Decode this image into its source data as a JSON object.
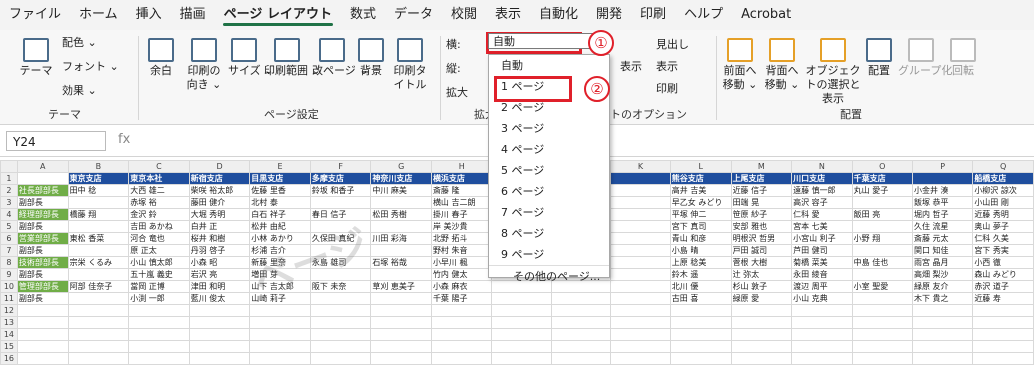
{
  "menu_tabs": [
    "ファイル",
    "ホーム",
    "挿入",
    "描画",
    "ページ レイアウト",
    "数式",
    "データ",
    "校閲",
    "表示",
    "自動化",
    "開発",
    "印刷",
    "ヘルプ",
    "Acrobat"
  ],
  "ribbon": {
    "theme_label": "テーマ",
    "colors": "配色 ⌄",
    "fonts": "フォント ⌄",
    "effects": "効果 ⌄",
    "group_theme": "テーマ",
    "margins": "余白",
    "orientation": "印刷の向き ⌄",
    "size": "サイズ ⌄",
    "print_area": "印刷範囲 ⌄",
    "breaks": "改ページ ⌄",
    "background": "背景",
    "print_titles": "印刷タイトル",
    "group_page_setup": "ページ設定",
    "width_label": "横:",
    "height_label": "縦:",
    "scale_label": "拡大",
    "group_scale": "拡大",
    "gridlines": "表示",
    "headings_title": "見出し",
    "headings_view": "表示",
    "headings_print": "印刷",
    "group_sheet_options": "トのオプション",
    "bring_forward": "前面へ移動 ⌄",
    "send_backward": "背面へ移動 ⌄",
    "selection_pane": "オブジェクトの選択と表示",
    "align": "配置",
    "group": "グループ化",
    "rotate": "回転",
    "group_arrange": "配置"
  },
  "formula": {
    "namebox": "Y24",
    "fx": "fx"
  },
  "dropdown": {
    "value": "自動",
    "items": [
      "自動",
      "1 ページ",
      "2 ページ",
      "3 ページ",
      "4 ページ",
      "5 ページ",
      "6 ページ",
      "7 ページ",
      "8 ページ",
      "9 ページ"
    ],
    "more": "その他のページ..."
  },
  "badges": [
    "①",
    "②"
  ],
  "sheet": {
    "columns": [
      "A",
      "B",
      "C",
      "D",
      "E",
      "F",
      "G",
      "H",
      "I",
      "J",
      "K",
      "L",
      "M",
      "N",
      "O",
      "P",
      "Q"
    ],
    "rows": [
      [
        "",
        "東京支店",
        "東京本社",
        "新宿支店",
        "目黒支店",
        "多摩支店",
        "神奈川支店",
        "横浜支店",
        "",
        "",
        "",
        "熊谷支店",
        "上尾支店",
        "川口支店",
        "千葉支店",
        "",
        "船橋支店"
      ],
      [
        "社長部部長",
        "田中 稔",
        "大西 雄二",
        "柴咲 裕太郎",
        "佐藤 里香",
        "鈴坂 和香子",
        "中川 麻美",
        "斎藤 隆",
        "",
        "",
        "",
        "高井 吉美",
        "近藤 信子",
        "遠藤 慎一郎",
        "丸山 愛子",
        "小金井 湊",
        "小柳沢 諒次"
      ],
      [
        "副部長",
        "",
        "赤塚 裕",
        "藤田 健介",
        "北村 泰",
        "",
        "",
        "横山 吉二朗",
        "",
        "",
        "",
        "早乙女 みどり",
        "田端 晃",
        "高沢 容子",
        "",
        "飯塚 恭平",
        "小山田 剛"
      ],
      [
        "経理部部長",
        "橋藤 翔",
        "金沢 鈴",
        "大堀 秀明",
        "白石 祥子",
        "春日 信子",
        "松田 秀樹",
        "掛川 春子",
        "",
        "",
        "",
        "平塚 伸二",
        "笹原 紗子",
        "仁科 愛",
        "飯田 亮",
        "堀内 哲子",
        "近藤 秀明"
      ],
      [
        "副部長",
        "",
        "吉田 あかね",
        "白井 正",
        "松井 由紀",
        "",
        "",
        "岸 美沙貴",
        "",
        "",
        "",
        "宮下 真司",
        "安部 雅也",
        "宮本 七美",
        "",
        "久住 流星",
        "奥山 夢子"
      ],
      [
        "営業部部長",
        "東松 香菜",
        "河合 竜也",
        "桜井 和樹",
        "小林 あかり",
        "久保田 真紀",
        "川田 彩海",
        "北野 拓斗",
        "",
        "",
        "",
        "青山 和彦",
        "明根沢 哲男",
        "小宮山 利子",
        "小野 翔",
        "斎藤 元太",
        "仁科 久美"
      ],
      [
        "副部長",
        "",
        "原 正太",
        "丹羽 啓子",
        "杉浦 吉介",
        "",
        "",
        "野村 朱音",
        "",
        "",
        "",
        "小島 晴",
        "戸田 誠司",
        "芦田 健司",
        "",
        "関口 知佳",
        "宮下 秀実"
      ],
      [
        "技術部部長",
        "宗栄 くるみ",
        "小山 慎太郎",
        "小森 昭",
        "新藤 里奈",
        "永島 雄司",
        "石塚 裕哉",
        "小早川 楓",
        "",
        "",
        "",
        "上原 稔美",
        "菅根 大樹",
        "菊橋 菜美",
        "中島 佳也",
        "雨宮 晶月",
        "小西 徹"
      ],
      [
        "副部長",
        "",
        "五十嵐 義史",
        "岩沢 亮",
        "増田 芽",
        "",
        "",
        "竹内 健太",
        "",
        "",
        "",
        "鈴木 遥",
        "辻 弥太",
        "永田 綾音",
        "",
        "高畑 梨沙",
        "森山 みどり"
      ],
      [
        "管理部部長",
        "阿部 佳奈子",
        "當岡 正博",
        "津田 和明",
        "山下 吉太郎",
        "阪下 未奈",
        "草刈 恵美子",
        "小森 麻衣",
        "",
        "",
        "",
        "北川 優",
        "杉山 敦子",
        "渡辺 周平",
        "小室 聖愛",
        "緑原 友介",
        "赤沢 道子"
      ],
      [
        "副部長",
        "",
        "小渕 一郎",
        "藍川 俊太",
        "山崎 莉子",
        "",
        "",
        "千葉 陽子",
        "",
        "",
        "",
        "古田 喜",
        "緑原 愛",
        "小山 克典",
        "",
        "木下 貴之",
        "近藤 寿"
      ]
    ],
    "row_numbers": [
      "1",
      "2",
      "3",
      "4",
      "5",
      "6",
      "7",
      "8",
      "9",
      "10",
      "11",
      "12",
      "13",
      "14",
      "15",
      "16"
    ]
  },
  "watermark": "ページ"
}
